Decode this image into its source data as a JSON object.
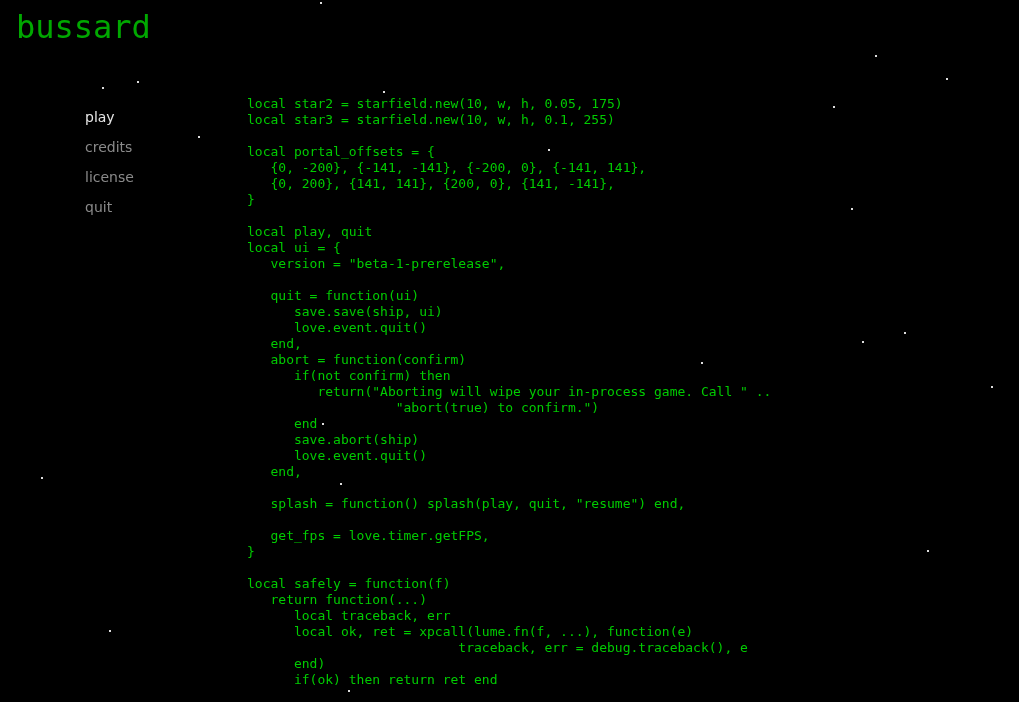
{
  "title": "bussard",
  "menu": [
    {
      "label": "play",
      "selected": true
    },
    {
      "label": "credits",
      "selected": false
    },
    {
      "label": "license",
      "selected": false
    },
    {
      "label": "quit",
      "selected": false
    }
  ],
  "code_blocks": [
    [
      "local star2 = starfield.new(10, w, h, 0.05, 175)",
      "local star3 = starfield.new(10, w, h, 0.1, 255)"
    ],
    [
      "local portal_offsets = {",
      "   {0, -200}, {-141, -141}, {-200, 0}, {-141, 141},",
      "   {0, 200}, {141, 141}, {200, 0}, {141, -141},",
      "}"
    ],
    [
      "local play, quit",
      "local ui = {",
      "   version = \"beta-1-prerelease\","
    ],
    [
      "   quit = function(ui)",
      "      save.save(ship, ui)",
      "      love.event.quit()",
      "   end,",
      "   abort = function(confirm)",
      "      if(not confirm) then",
      "         return(\"Aborting will wipe your in-process game. Call \" ..",
      "                   \"abort(true) to confirm.\")",
      "      end",
      "      save.abort(ship)",
      "      love.event.quit()",
      "   end,"
    ],
    [
      "   splash = function() splash(play, quit, \"resume\") end,"
    ],
    [
      "   get_fps = love.timer.getFPS,",
      "}"
    ],
    [
      "local safely = function(f)",
      "   return function(...)",
      "      local traceback, err",
      "      local ok, ret = xpcall(lume.fn(f, ...), function(e)",
      "                           traceback, err = debug.traceback(), e",
      "      end)",
      "      if(ok) then return ret end"
    ]
  ]
}
